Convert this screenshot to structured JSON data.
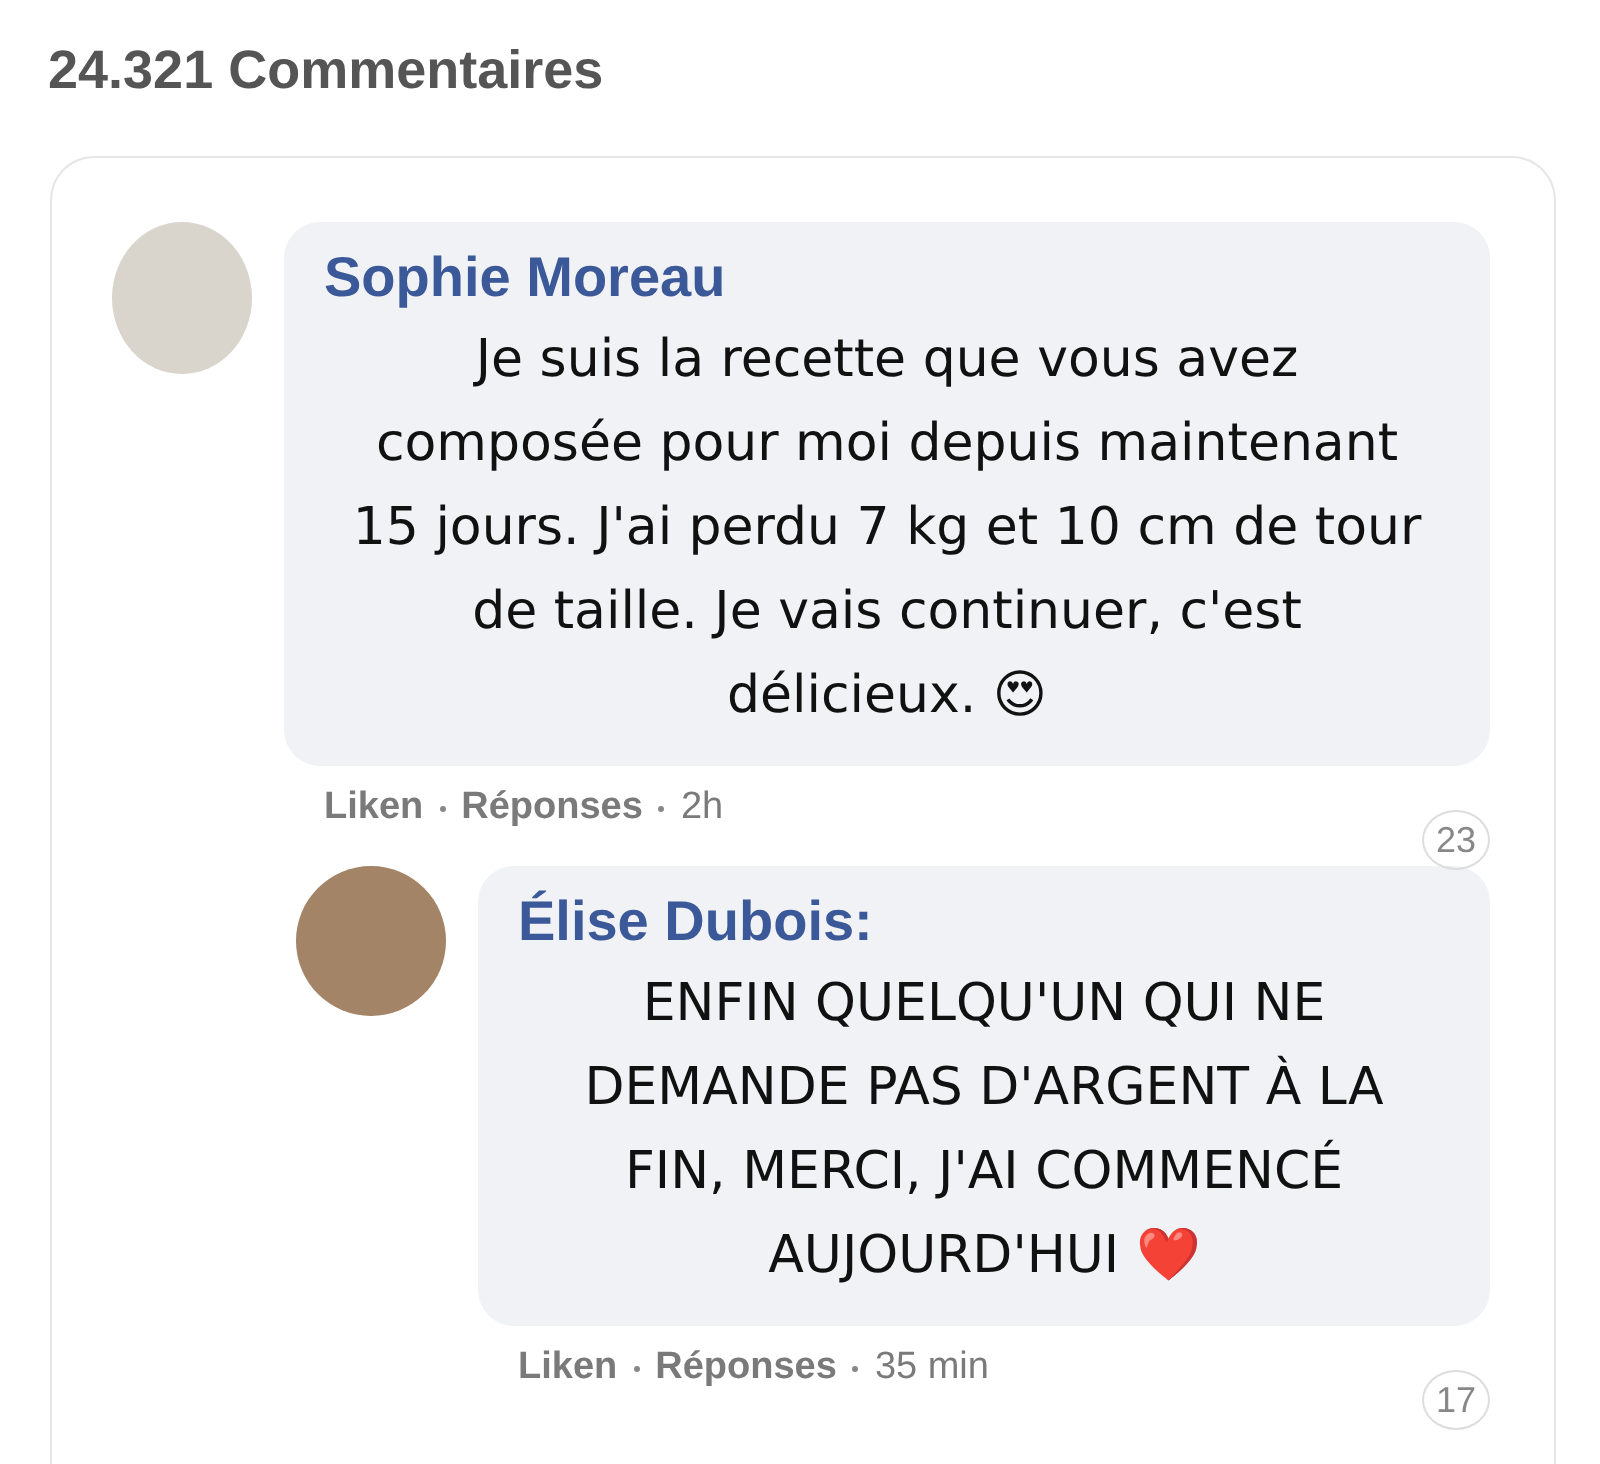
{
  "heading": "24.321 Commentaires",
  "comments": [
    {
      "author": "Sophie Moreau",
      "text": "Je suis la recette que vous avez composée pour moi depuis maintenant 15 jours. J'ai perdu 7 kg et 10 cm de tour de taille. Je vais continuer, c'est délicieux. 😍",
      "actions": [
        "Liken",
        "Réponses"
      ],
      "time": "2h",
      "count": "23",
      "replies": [
        {
          "author": "Élise Dubois:",
          "text": "ENFIN QUELQU'UN QUI NE DEMANDE PAS D'ARGENT À LA FIN, MERCI, J'AI COMMENCÉ AUJOURD'HUI ❤️",
          "actions": [
            "Liken",
            "Réponses"
          ],
          "time": "35 min",
          "count": "17"
        }
      ]
    }
  ]
}
